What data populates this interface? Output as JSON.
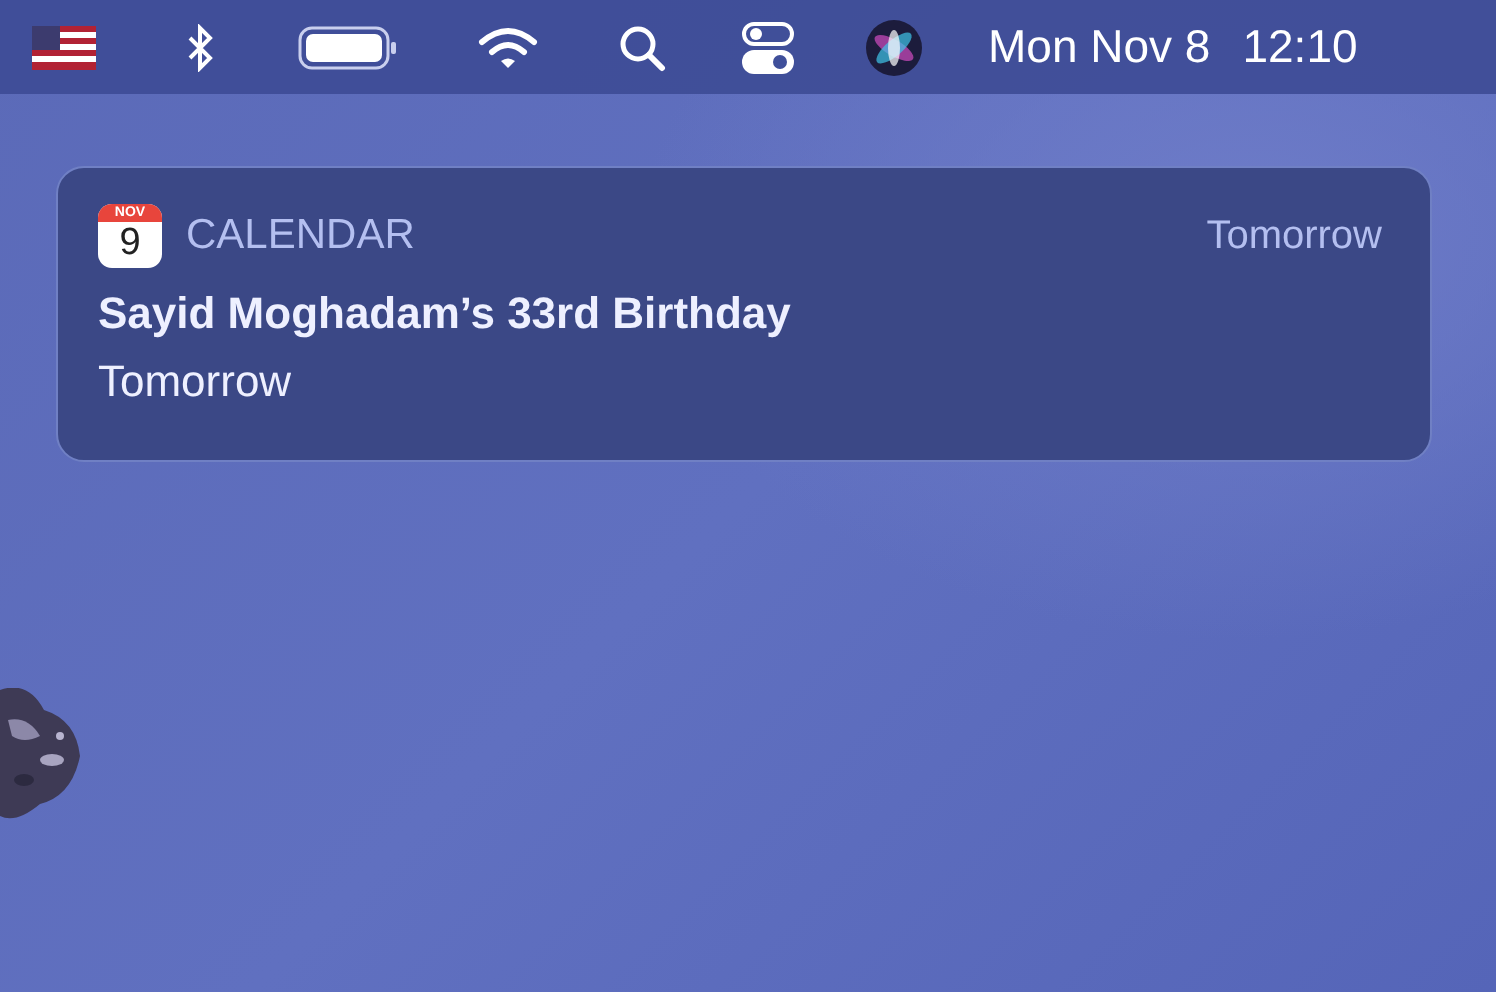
{
  "menu_bar": {
    "date": "Mon Nov 8",
    "time": "12:10"
  },
  "notification": {
    "app": "CALENDAR",
    "calendar_icon": {
      "month": "NOV",
      "day": "9"
    },
    "time": "Tomorrow",
    "title": "Sayid Moghadam’s 33rd Birthday",
    "body": "Tomorrow"
  }
}
